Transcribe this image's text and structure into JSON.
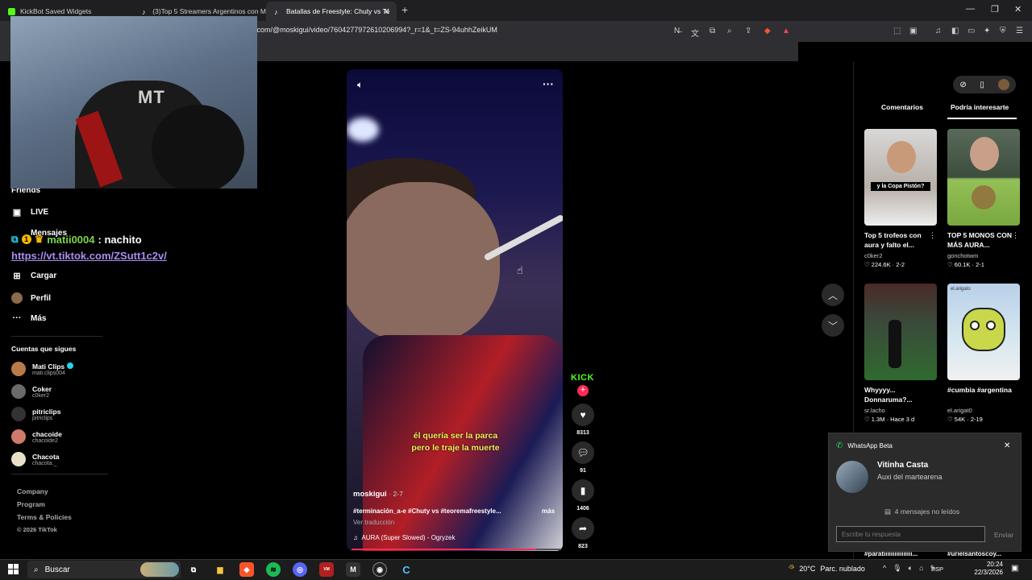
{
  "browser": {
    "tabs": [
      {
        "label": "KickBot Saved Widgets"
      },
      {
        "label": "(3)Top 5 Streamers Argentinos con M"
      },
      {
        "label": "Batallas de Freestyle: Chuty vs Te"
      }
    ],
    "url": ".com/@moskigui/video/7604277972610206994?_r=1&_t=ZS-94uhhZeikUM"
  },
  "left_nav": {
    "items": [
      {
        "label": "Friends"
      },
      {
        "label": "LIVE"
      },
      {
        "label": "Mensajes"
      },
      {
        "label": "Cargar"
      },
      {
        "label": "Perfil"
      },
      {
        "label": "Más"
      }
    ],
    "following_title": "Cuentas que sigues",
    "accounts": [
      {
        "name": "Mati Clips",
        "handle": "mati.clips004",
        "verified": true,
        "color": "#b97a4a"
      },
      {
        "name": "Coker",
        "handle": "c0ker2",
        "verified": false,
        "color": "#6a6a6a"
      },
      {
        "name": "pitriclips",
        "handle": "pitriclips",
        "verified": false,
        "color": "#222"
      },
      {
        "name": "chacoide",
        "handle": "chacoide2",
        "verified": false,
        "color": "#d07a6a"
      },
      {
        "name": "Chacota",
        "handle": "chacota._",
        "verified": false,
        "color": "#e8e0c8"
      }
    ],
    "footer": [
      "Company",
      "Program",
      "Terms & Policies",
      "© 2026 TikTok"
    ]
  },
  "chat_overlay": {
    "username": "matii0004",
    "message": ": nachito",
    "link": "https://vt.tiktok.com/ZSutt1c2v/"
  },
  "video": {
    "subtitle_line1": "él quería ser la parca",
    "subtitle_line2": "pero le traje la muerte",
    "author": "moskigui",
    "date": "· 2-7",
    "description": "#terminación_a-e #Chuty vs #teoremafreestyle...",
    "more": "más",
    "translate": "Ver traducción",
    "music": "AURA (Super Slowed) - Ogryzek",
    "progress": 0.88,
    "sponsor_label": "KICK",
    "likes": "8313",
    "comments": "91",
    "saves": "1406",
    "shares": "823"
  },
  "right_pane": {
    "tabs": [
      "Comentarios",
      "Podría interesarte"
    ],
    "active_tab": "Podría interesarte",
    "cards": [
      {
        "title": "Top 5 trofeos con aura y falto el...",
        "author": "c0ker2",
        "stats": "♡ 224.6K · 2-2",
        "thumb_text": "y la Copa Pistón?"
      },
      {
        "title": "TOP 5 MONOS CON MÁS AURA...",
        "author": "gonchotwm",
        "stats": "♡ 60.1K · 2-1",
        "thumb_text": ""
      },
      {
        "title": "Whyyyy... Donnaruma?...",
        "author": "sr.lacho",
        "stats": "♡ 1.3M · Hace 3 d",
        "thumb_text": ""
      },
      {
        "title": "#cumbia #argentina",
        "author": "el.arigat0",
        "stats": "♡ 54K · 2-19",
        "thumb_text": "el.arigato"
      }
    ],
    "peek": [
      "#paratiiiiiiiiiiiiiiii...",
      "#urielsantoscoy..."
    ]
  },
  "whatsapp": {
    "app": "WhatsApp Beta",
    "sender": "Vitinha Casta",
    "message": "Auxi del martearena",
    "unread": "4 mensajes no leídos",
    "placeholder": "Escribe tu respuesta",
    "send": "Enviar"
  },
  "taskbar": {
    "search": "Buscar",
    "temp": "20°C",
    "weather": "Parc. nublado",
    "lang": "ESP",
    "time": "20:24",
    "date": "22/3/2026"
  }
}
